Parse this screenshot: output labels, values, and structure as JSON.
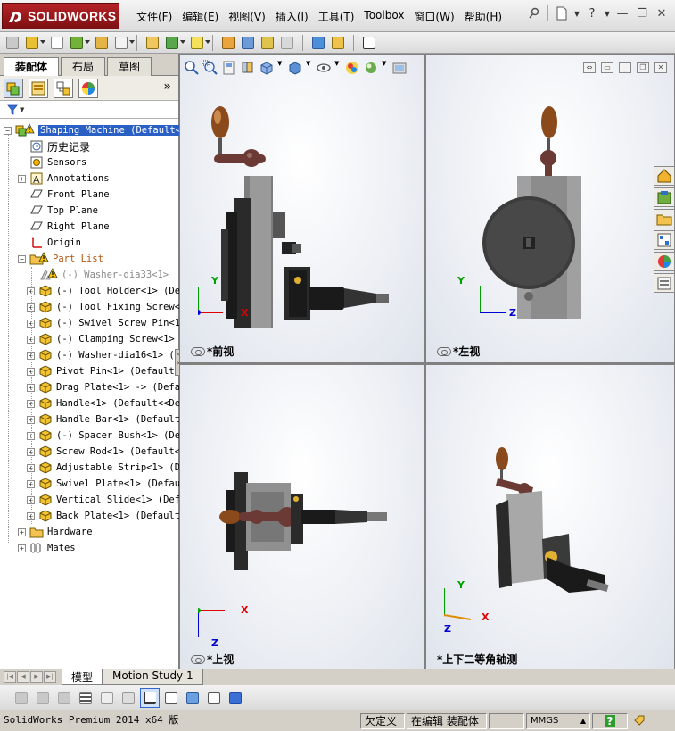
{
  "app": {
    "logo_text": "SOLIDWORKS",
    "logo_ds": "DS"
  },
  "menu": [
    {
      "label": "文件(F)"
    },
    {
      "label": "编辑(E)"
    },
    {
      "label": "视图(V)"
    },
    {
      "label": "插入(I)"
    },
    {
      "label": "工具(T)"
    },
    {
      "label": "Toolbox"
    },
    {
      "label": "窗口(W)"
    },
    {
      "label": "帮助(H)"
    }
  ],
  "left_panel": {
    "tabs": [
      "装配体",
      "布局",
      "草图"
    ],
    "more_glyph": "»",
    "filter_glyph": "▼"
  },
  "tree": [
    {
      "label": "Shaping Machine  (Default<",
      "icon": "assembly-warning",
      "level": 0,
      "expander": "−",
      "style": "sel"
    },
    {
      "label": "历史记录",
      "icon": "history",
      "level": 1,
      "style": "cjk"
    },
    {
      "label": "Sensors",
      "icon": "sensor",
      "level": 1
    },
    {
      "label": "Annotations",
      "icon": "annotation",
      "level": 1,
      "expander": "+"
    },
    {
      "label": "Front Plane",
      "icon": "plane",
      "level": 1
    },
    {
      "label": "Top Plane",
      "icon": "plane",
      "level": 1
    },
    {
      "label": "Right Plane",
      "icon": "plane",
      "level": 1
    },
    {
      "label": "Origin",
      "icon": "origin",
      "level": 1
    },
    {
      "label": "Part List",
      "icon": "folder-warning",
      "level": 1,
      "expander": "−",
      "style": "orange"
    },
    {
      "label": "(-) Washer-dia33<1>",
      "icon": "part-warning",
      "level": 2,
      "style": "grey"
    },
    {
      "label": "(-) Tool Holder<1> (Def",
      "icon": "part",
      "level": 2,
      "expander": "+"
    },
    {
      "label": "(-) Tool Fixing Screw<1",
      "icon": "part",
      "level": 2,
      "expander": "+"
    },
    {
      "label": "(-) Swivel Screw Pin<1>",
      "icon": "part",
      "level": 2,
      "expander": "+"
    },
    {
      "label": "(-) Clamping Screw<1>",
      "icon": "part",
      "level": 2,
      "expander": "+"
    },
    {
      "label": "(-) Washer-dia16<1> (De",
      "icon": "part",
      "level": 2,
      "expander": "+"
    },
    {
      "label": "Pivot Pin<1> (Default<<",
      "icon": "part",
      "level": 2,
      "expander": "+"
    },
    {
      "label": "Drag Plate<1> -> (Defau",
      "icon": "part",
      "level": 2,
      "expander": "+"
    },
    {
      "label": "Handle<1> (Default<<Def",
      "icon": "part",
      "level": 2,
      "expander": "+"
    },
    {
      "label": "Handle Bar<1> (Default<",
      "icon": "part",
      "level": 2,
      "expander": "+"
    },
    {
      "label": "(-) Spacer Bush<1> (Def",
      "icon": "part",
      "level": 2,
      "expander": "+"
    },
    {
      "label": "Screw Rod<1> (Default<<",
      "icon": "part",
      "level": 2,
      "expander": "+"
    },
    {
      "label": "Adjustable Strip<1> (De",
      "icon": "part",
      "level": 2,
      "expander": "+"
    },
    {
      "label": "Swivel Plate<1> (Defaul",
      "icon": "part",
      "level": 2,
      "expander": "+"
    },
    {
      "label": "Vertical Slide<1> (Defa",
      "icon": "part",
      "level": 2,
      "expander": "+"
    },
    {
      "label": "Back Plate<1> (Default<",
      "icon": "part",
      "level": 2,
      "expander": "+"
    },
    {
      "label": "Hardware",
      "icon": "folder",
      "level": 1,
      "expander": "+"
    },
    {
      "label": "Mates",
      "icon": "mates",
      "level": 1,
      "expander": "+"
    }
  ],
  "viewports": {
    "front": {
      "label": "*前视"
    },
    "left": {
      "label": "*左视"
    },
    "top": {
      "label": "*上视"
    },
    "iso": {
      "label": "*上下二等角轴测"
    }
  },
  "triad": {
    "x": "X",
    "y": "Y",
    "z": "Z"
  },
  "bottom_tabs": [
    "模型",
    "Motion Study 1"
  ],
  "status": {
    "product": "SolidWorks Premium 2014 x64 版",
    "state": "欠定义",
    "editing": "在编辑 装配体",
    "units": "MMGS",
    "units_arrow": "▲",
    "help": "?"
  },
  "colors": {
    "logo_red": "#9c1a1d",
    "selection": "#2a5fc4",
    "warning": "#f3c300",
    "axis_x": "#e00000",
    "axis_y": "#00a000",
    "axis_z": "#0000d0"
  }
}
